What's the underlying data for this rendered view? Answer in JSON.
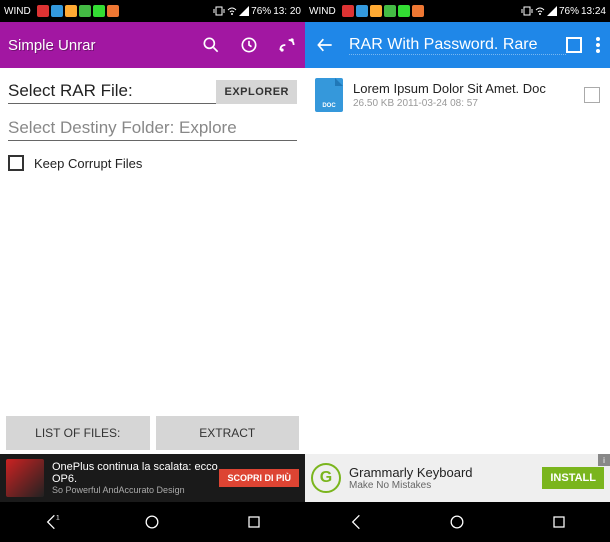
{
  "left": {
    "status": {
      "carrier": "WIND",
      "battery": "76%",
      "time": "13: 20"
    },
    "appbar": {
      "title": "Simple Unrar"
    },
    "fields": {
      "select_rar": "Select RAR File:",
      "explorer_btn": "EXPLORER",
      "select_dest": "Select Destiny Folder: Explore",
      "keep_corrupt": "Keep Corrupt Files"
    },
    "buttons": {
      "list": "LIST OF FILES:",
      "extract": "EXTRACT"
    },
    "ad": {
      "title": "OnePlus continua la scalata: ecco OP6.",
      "sub": "So Powerful AndAccurato Design",
      "cta": "SCOPRI DI PIÙ"
    }
  },
  "right": {
    "status": {
      "carrier": "WIND",
      "battery": "76%",
      "time": "13:24"
    },
    "appbar": {
      "title": "RAR With Password. Rare"
    },
    "file": {
      "name": "Lorem Ipsum Dolor Sit Amet. Doc",
      "meta": "26.50 KB 2011-03-24 08: 57",
      "icon_text": "DOC"
    },
    "ad": {
      "title": "Grammarly Keyboard",
      "sub": "Make No Mistakes",
      "cta": "INSTALL"
    }
  }
}
